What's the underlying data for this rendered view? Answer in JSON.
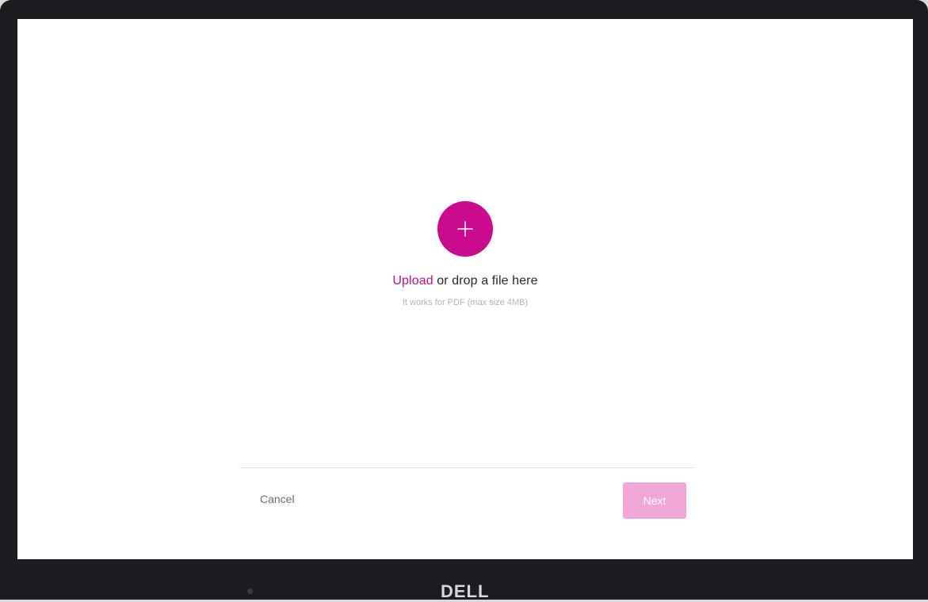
{
  "upload": {
    "link_label": "Upload",
    "rest_label": " or drop a file here",
    "hint": "It works for PDF (max size 4MB)",
    "add_icon": "plus-icon"
  },
  "footer": {
    "cancel_label": "Cancel",
    "next_label": "Next",
    "next_disabled": true
  },
  "device": {
    "brand": "DELL"
  },
  "colors": {
    "accent": "#cc0a8e",
    "accent_disabled": "#f2a6d6",
    "bezel": "#1c1c20",
    "text_primary": "#2b2b2b",
    "text_muted": "#b3b3b8"
  }
}
